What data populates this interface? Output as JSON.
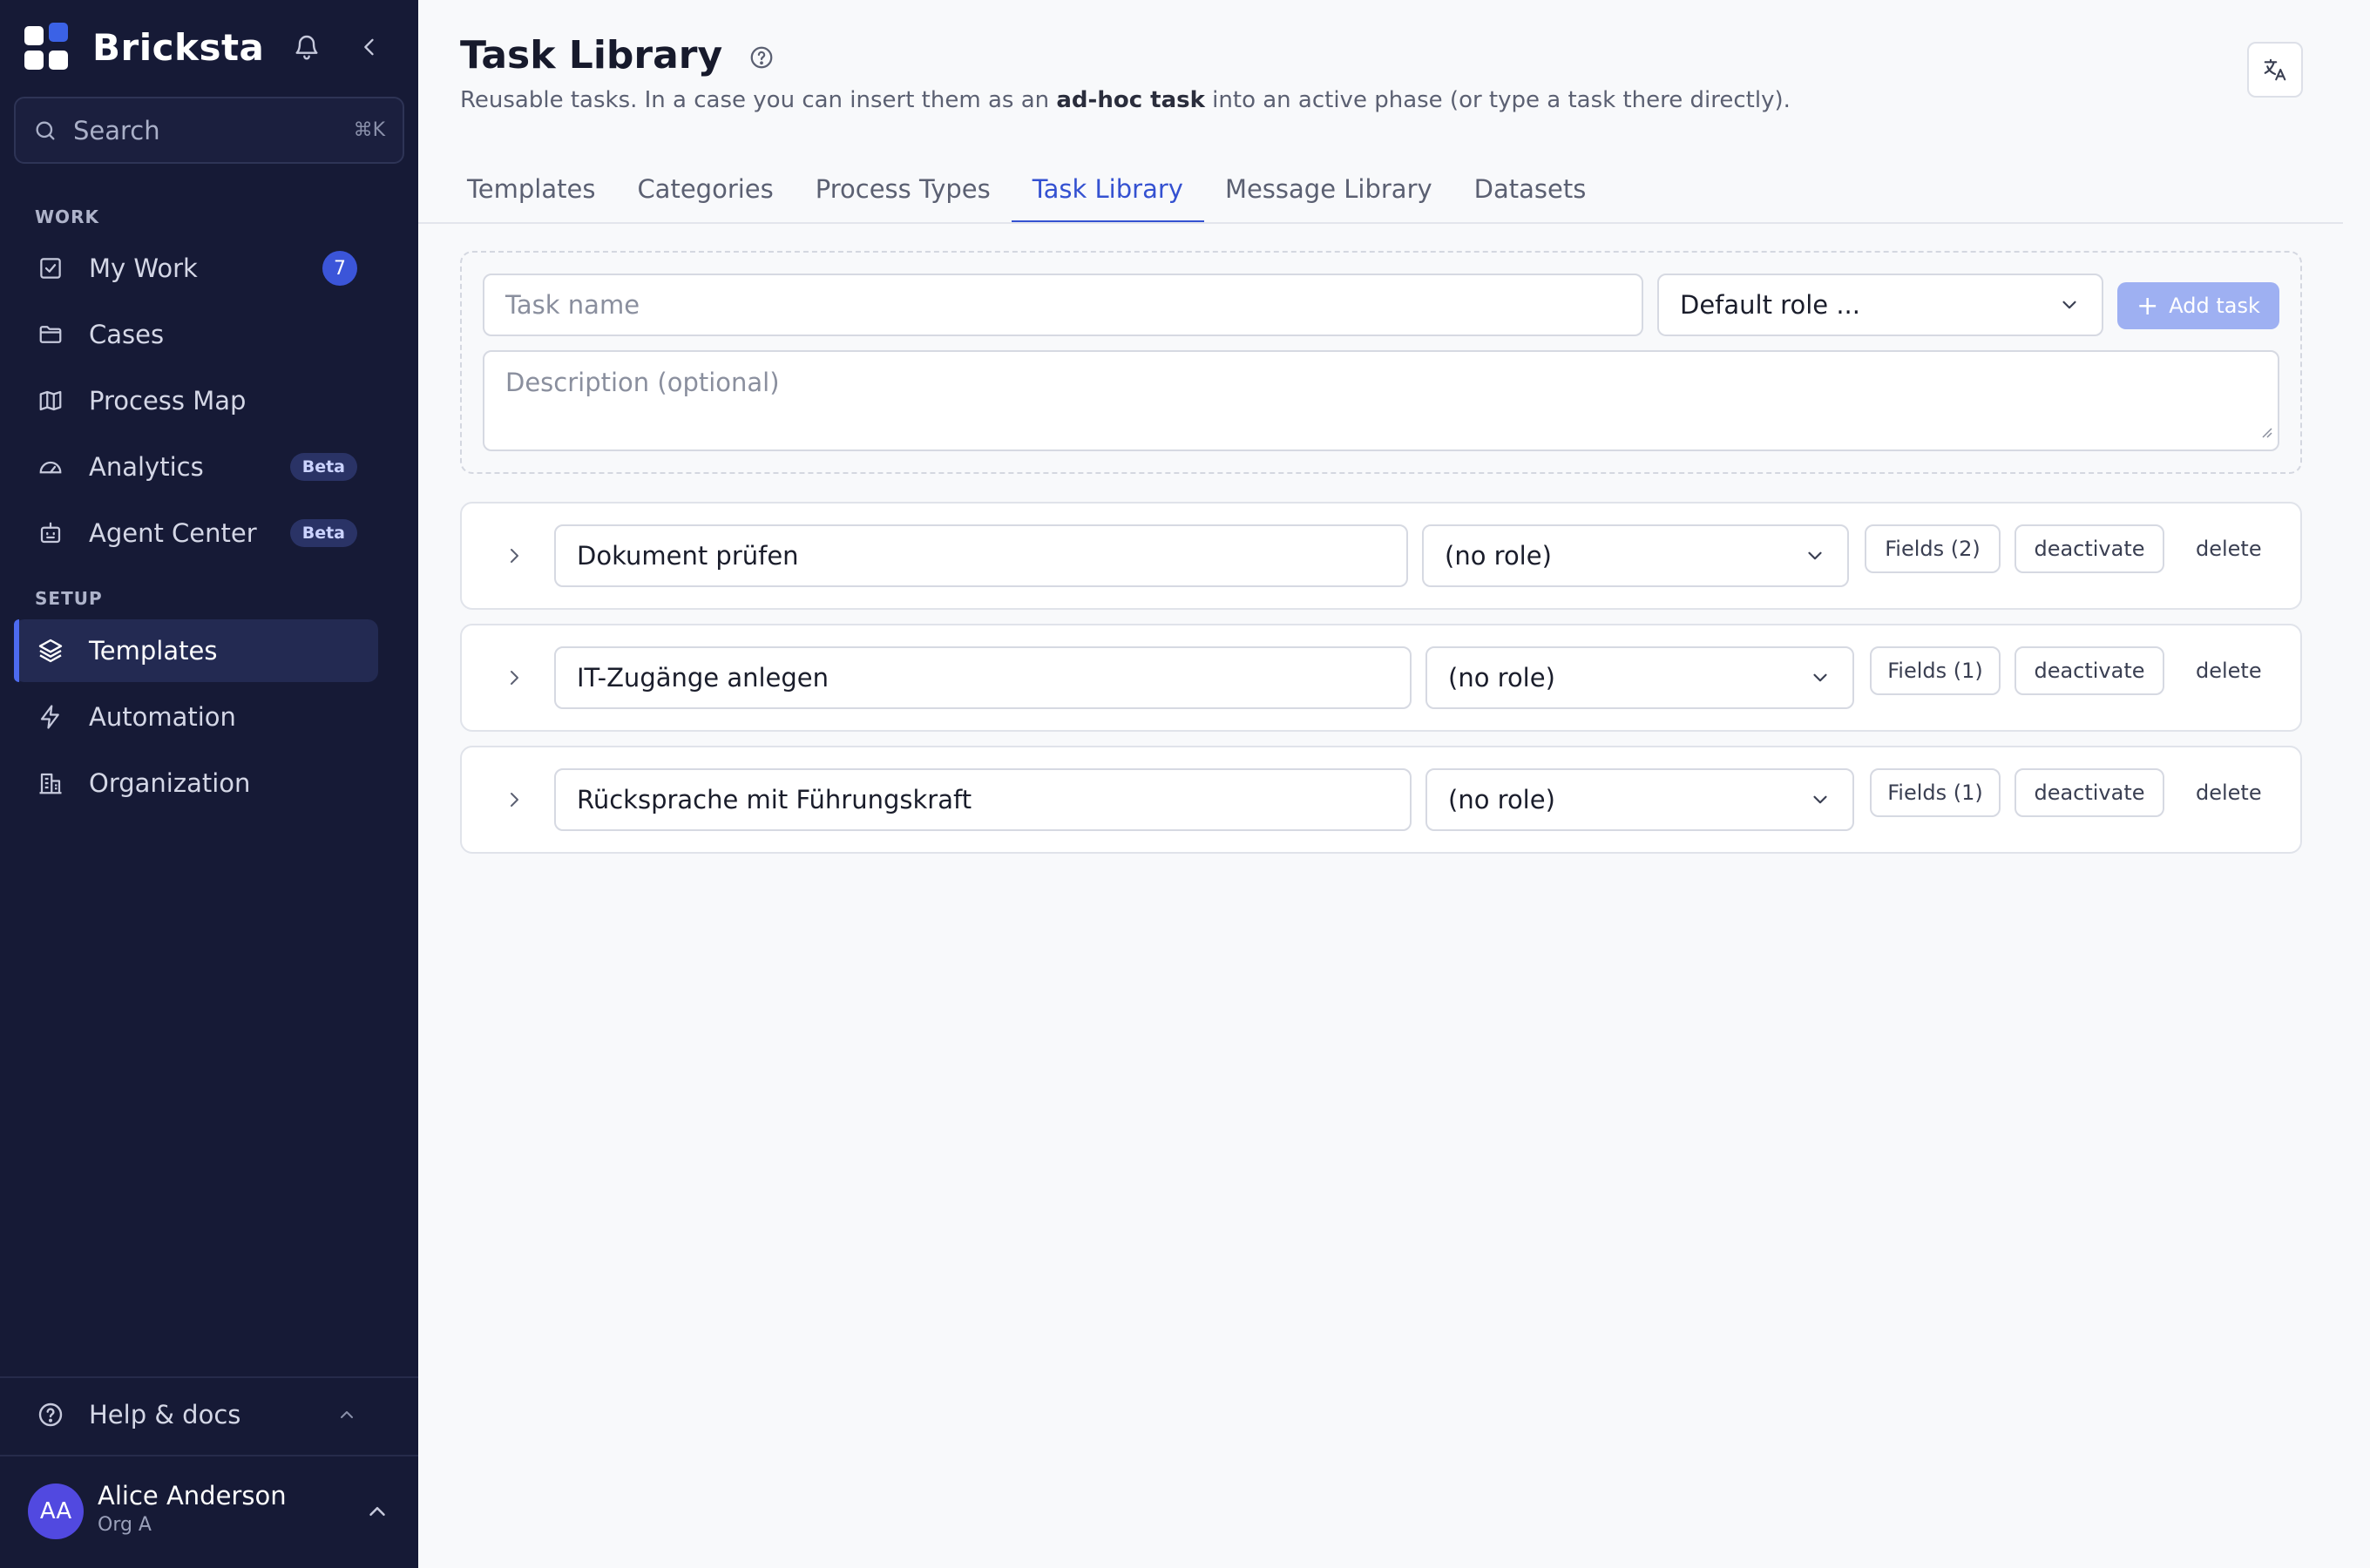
{
  "app": {
    "name": "Bricksta"
  },
  "icons": {
    "logo": "bricksta-logo",
    "bell": "bell-icon",
    "collapse": "chevron-left-icon",
    "search": "search-icon",
    "help": "help-circle-icon",
    "translate": "translate-icon"
  },
  "colors": {
    "sidebar_bg": "#161a36",
    "accent": "#3451d1",
    "badge": "#3b55d9",
    "add_button": "#9eb0f2"
  },
  "search": {
    "placeholder": "Search",
    "shortcut": "⌘K"
  },
  "sidebar": {
    "sections": [
      {
        "label": "WORK",
        "items": [
          {
            "label": "My Work",
            "icon": "checkbox-icon",
            "badge": "7"
          },
          {
            "label": "Cases",
            "icon": "folder-icon"
          },
          {
            "label": "Process Map",
            "icon": "map-icon"
          },
          {
            "label": "Analytics",
            "icon": "gauge-icon",
            "badge": "Beta"
          },
          {
            "label": "Agent Center",
            "icon": "robot-icon",
            "badge": "Beta"
          }
        ]
      },
      {
        "label": "SETUP",
        "items": [
          {
            "label": "Templates",
            "icon": "layers-icon",
            "active": true
          },
          {
            "label": "Automation",
            "icon": "lightning-icon"
          },
          {
            "label": "Organization",
            "icon": "building-icon"
          }
        ]
      }
    ],
    "help": {
      "label": "Help & docs"
    },
    "user": {
      "initials": "AA",
      "name": "Alice Anderson",
      "org": "Org A"
    }
  },
  "page": {
    "title": "Task Library",
    "subtitle_pre": "Reusable tasks. In a case you can insert them as an ",
    "subtitle_bold": "ad-hoc task",
    "subtitle_post": " into an active phase (or type a task there directly)."
  },
  "tabs": [
    {
      "label": "Templates"
    },
    {
      "label": "Categories"
    },
    {
      "label": "Process Types"
    },
    {
      "label": "Task Library",
      "active": true
    },
    {
      "label": "Message Library"
    },
    {
      "label": "Datasets"
    }
  ],
  "new_task": {
    "name_placeholder": "Task name",
    "role_placeholder": "Default role ...",
    "add_label": "Add task",
    "description_placeholder": "Description (optional)"
  },
  "tasks": [
    {
      "name": "Dokument prüfen",
      "role": "(no role)",
      "fields": "Fields (2)",
      "deactivate": "deactivate",
      "delete": "delete"
    },
    {
      "name": "IT-Zugänge anlegen",
      "role": "(no role)",
      "fields": "Fields (1)",
      "deactivate": "deactivate",
      "delete": "delete"
    },
    {
      "name": "Rücksprache mit Führungskraft",
      "role": "(no role)",
      "fields": "Fields (1)",
      "deactivate": "deactivate",
      "delete": "delete"
    }
  ]
}
